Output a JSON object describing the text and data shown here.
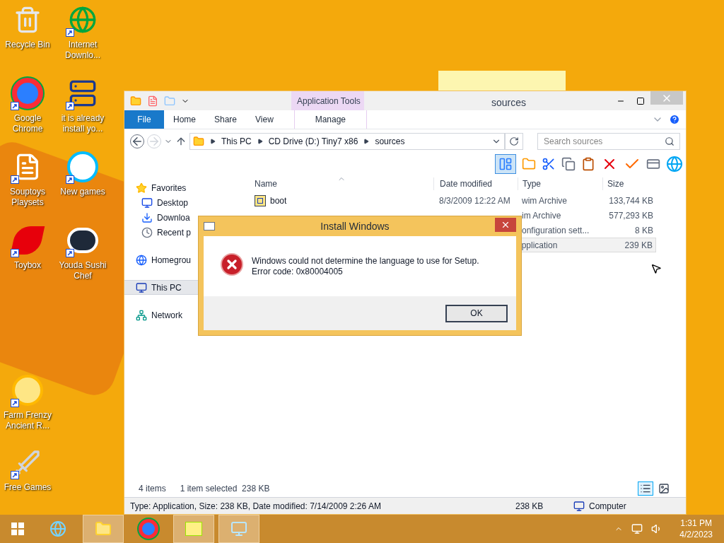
{
  "desktop_icons": [
    {
      "label": "Recycle Bin",
      "kind": "bin",
      "shortcut": false
    },
    {
      "label": "Internet Downlo...",
      "kind": "globe",
      "shortcut": true
    },
    {
      "label": "Google Chrome",
      "kind": "chrome",
      "shortcut": true
    },
    {
      "label": "it is already install yo...",
      "kind": "setup",
      "shortcut": true
    },
    {
      "label": "Souptoys Playsets",
      "kind": "doc",
      "shortcut": true
    },
    {
      "label": "New games",
      "kind": "w",
      "shortcut": true
    },
    {
      "label": "Toybox",
      "kind": "s",
      "shortcut": true
    },
    {
      "label": "Youda Sushi Chef",
      "kind": "sushi",
      "shortcut": true
    },
    {
      "label": "Farm Frenzy Ancient R...",
      "kind": "farm",
      "shortcut": true
    },
    {
      "label": "Free Games",
      "kind": "sword",
      "shortcut": true
    }
  ],
  "explorer": {
    "title": "sources",
    "context_group": "Application Tools",
    "ribbon_tabs": [
      {
        "label": "File",
        "kind": "file"
      },
      {
        "label": "Home",
        "kind": "tab"
      },
      {
        "label": "Share",
        "kind": "tab"
      },
      {
        "label": "View",
        "kind": "tab"
      },
      {
        "label": "Manage",
        "kind": "contextual"
      }
    ],
    "breadcrumb": [
      "This PC",
      "CD Drive (D:) Tiny7 x86",
      "sources"
    ],
    "search": {
      "placeholder": "Search sources"
    },
    "preview_pane_on": true,
    "nav": [
      {
        "label": "Favorites",
        "kind": "star",
        "selected": false,
        "children": [
          {
            "label": "Desktop",
            "kind": "desktop",
            "selected": false
          },
          {
            "label": "Downloa",
            "kind": "download",
            "selected": false
          },
          {
            "label": "Recent p",
            "kind": "recent",
            "selected": false
          }
        ]
      },
      {
        "label": "Homegrou",
        "kind": "home",
        "selected": false
      },
      {
        "label": "This PC",
        "kind": "pc",
        "selected": true
      },
      {
        "label": "Network",
        "kind": "network",
        "selected": false
      }
    ],
    "columns": [
      "Name",
      "Date modified",
      "Type",
      "Size"
    ],
    "rows": [
      {
        "name": "boot",
        "date": "8/3/2009 12:22 AM",
        "type": "wim Archive",
        "size": "133,744 KB",
        "selected": false
      },
      {
        "name": "",
        "date": "",
        "type": "im Archive",
        "size": "577,293 KB",
        "selected": false
      },
      {
        "name": "",
        "date": "",
        "type": "onfiguration sett...",
        "size": "8 KB",
        "selected": false
      },
      {
        "name": "",
        "date": "",
        "type": "pplication",
        "size": "239 KB",
        "selected": true
      }
    ],
    "item_count": "4 items",
    "selection": "1 item selected  238 KB",
    "view_details_selected": true,
    "details_bar": {
      "info": "Type: Application, Size: 238 KB, Date modified: 7/14/2009 2:26 AM",
      "size": "238 KB",
      "location": "Computer"
    }
  },
  "dialog": {
    "title": "Install Windows",
    "message": "Windows could not determine the language to use for Setup. Error code: 0x80004005",
    "button": "OK"
  },
  "taskbar": {
    "apps": [
      {
        "kind": "ie",
        "active": false
      },
      {
        "kind": "explorer",
        "active": true
      },
      {
        "kind": "chrome",
        "active": false
      },
      {
        "kind": "notes",
        "active": true
      },
      {
        "kind": "setup",
        "active": true
      }
    ],
    "time": "1:31 PM",
    "date": "4/2/2023"
  }
}
